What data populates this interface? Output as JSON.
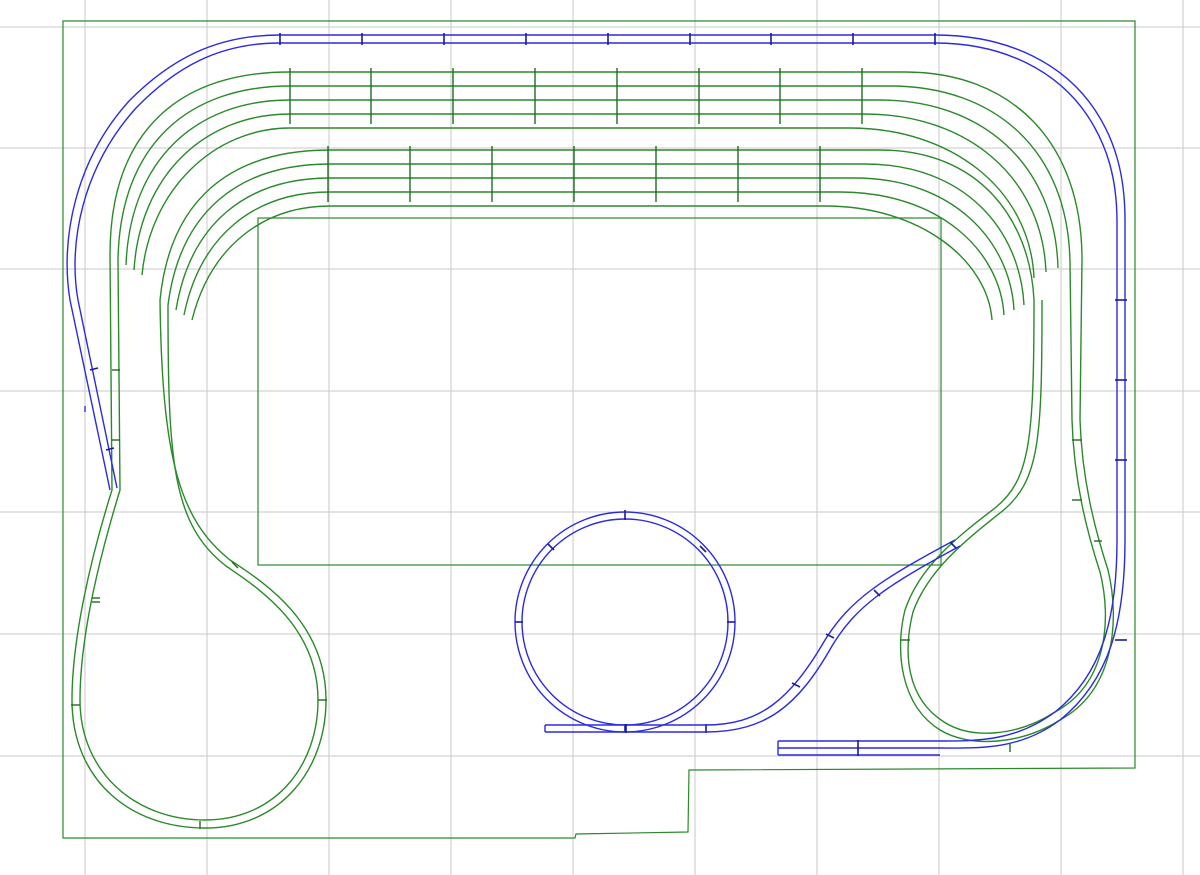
{
  "canvas": {
    "background": "#ffffff",
    "grid_color": "#c8c8c8",
    "grid": "on"
  },
  "colors": {
    "upper_level_track": "#2a2ae0",
    "lower_level_track": "#2a8a2a",
    "benchwork_outline": "#2a8a2a"
  },
  "elements": {
    "benchwork": "layout-benchwork-outline",
    "center_panel": "center-scenery-panel",
    "upper_yard": "upper-staging-yard",
    "lower_yard": "lower-staging-yard",
    "helix": "helix-loop",
    "left_reversing_loop": "left-reversing-loop",
    "right_reversing_loop": "right-reversing-loop",
    "mainline_upper": "mainline-upper-level",
    "mainline_lower": "mainline-lower-level"
  }
}
